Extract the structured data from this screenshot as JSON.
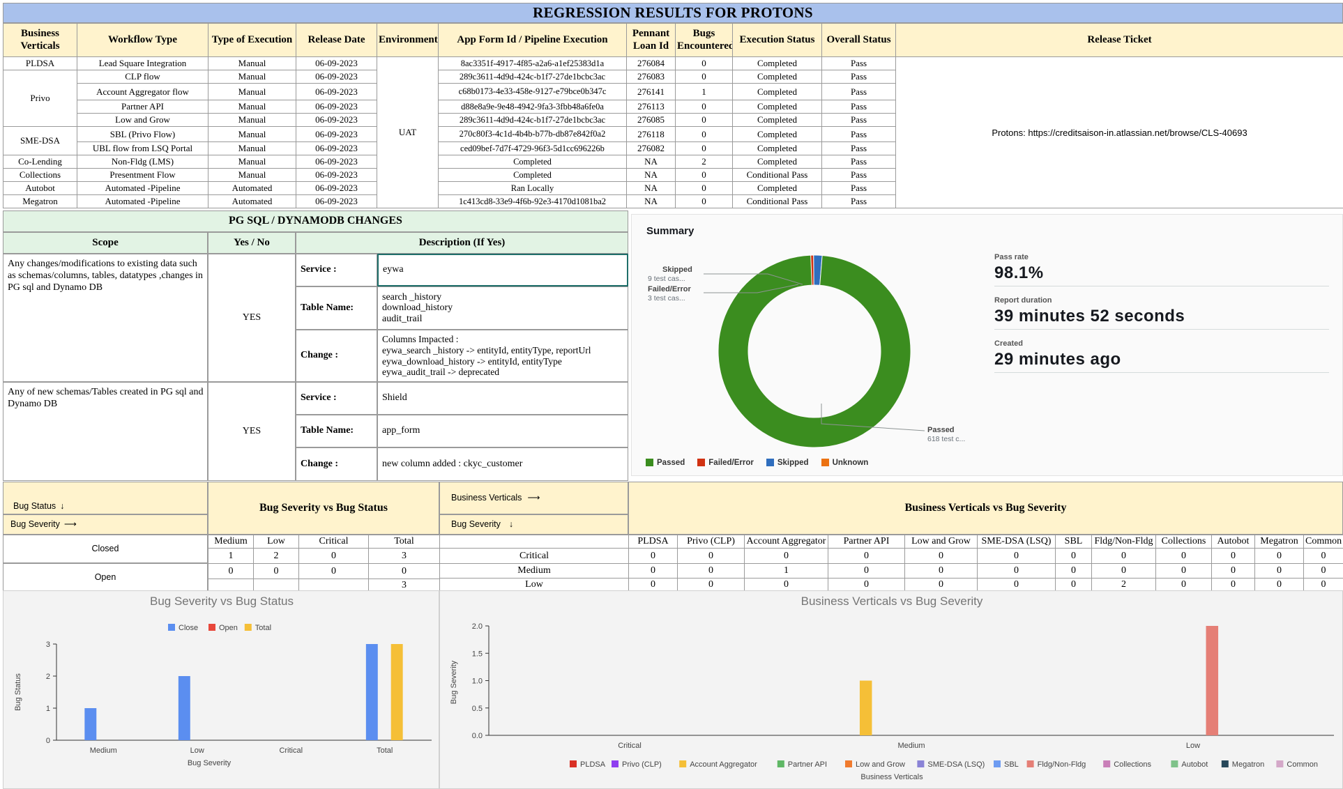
{
  "title": "REGRESSION RESULTS FOR PROTONS",
  "results_table": {
    "headers": [
      "Business Verticals",
      "Workflow Type",
      "Type of Execution",
      "Release Date",
      "Environment",
      "App Form Id / Pipeline Execution",
      "Pennant Loan Id",
      "Bugs Encountered",
      "Execution Status",
      "Overall Status",
      "Release Ticket"
    ],
    "verticals": [
      "PLDSA",
      "Privo",
      "SME-DSA",
      "Co-Lending",
      "Collections",
      "Autobot",
      "Megatron"
    ],
    "environment": "UAT",
    "release_ticket": "Protons: https://creditsaison-in.atlassian.net/browse/CLS-40693",
    "rows": [
      {
        "workflow": "Lead Square Integration",
        "execution": "Manual",
        "date": "06-09-2023",
        "app_id": "8ac3351f-4917-4f85-a2a6-a1ef25383d1a",
        "loan": "276084",
        "bugs": "0",
        "exec_status": "Completed",
        "overall": "Pass"
      },
      {
        "workflow": "CLP flow",
        "execution": "Manual",
        "date": "06-09-2023",
        "app_id": "289c3611-4d9d-424c-b1f7-27de1bcbc3ac",
        "loan": "276083",
        "bugs": "0",
        "exec_status": "Completed",
        "overall": "Pass"
      },
      {
        "workflow": "Account Aggregator flow",
        "execution": "Manual",
        "date": "06-09-2023",
        "app_id": "c68b0173-4e33-458e-9127-e79bce0b347c",
        "loan": "276141",
        "bugs": "1",
        "exec_status": "Completed",
        "overall": "Pass"
      },
      {
        "workflow": "Partner API",
        "execution": "Manual",
        "date": "06-09-2023",
        "app_id": "d88e8a9e-9e48-4942-9fa3-3fbb48a6fe0a",
        "loan": "276113",
        "bugs": "0",
        "exec_status": "Completed",
        "overall": "Pass"
      },
      {
        "workflow": "Low and Grow",
        "execution": "Manual",
        "date": "06-09-2023",
        "app_id": "289c3611-4d9d-424c-b1f7-27de1bcbc3ac",
        "loan": "276085",
        "bugs": "0",
        "exec_status": "Completed",
        "overall": "Pass"
      },
      {
        "workflow": "SBL (Privo Flow)",
        "execution": "Manual",
        "date": "06-09-2023",
        "app_id": "270c80f3-4c1d-4b4b-b77b-db87e842f0a2",
        "loan": "276118",
        "bugs": "0",
        "exec_status": "Completed",
        "overall": "Pass"
      },
      {
        "workflow": "UBL flow from  LSQ Portal",
        "execution": "Manual",
        "date": "06-09-2023",
        "app_id": "ced09bef-7d7f-4729-96f3-5d1cc696226b",
        "loan": "276082",
        "bugs": "0",
        "exec_status": "Completed",
        "overall": "Pass"
      },
      {
        "workflow": "Non-Fldg (LMS)",
        "execution": "Manual",
        "date": "06-09-2023",
        "app_id": "Completed",
        "loan": "NA",
        "bugs": "2",
        "exec_status": "Completed",
        "overall": "Pass"
      },
      {
        "workflow": "Presentment Flow",
        "execution": "Manual",
        "date": "06-09-2023",
        "app_id": "Completed",
        "loan": "NA",
        "bugs": "0",
        "exec_status": "Conditional Pass",
        "overall": "Pass"
      },
      {
        "workflow": "Automated -Pipeline",
        "execution": "Automated",
        "date": "06-09-2023",
        "app_id": "Ran Locally",
        "loan": "NA",
        "bugs": "0",
        "exec_status": "Completed",
        "overall": "Pass"
      },
      {
        "workflow": "Automated -Pipeline",
        "execution": "Automated",
        "date": "06-09-2023",
        "app_id": "1c413cd8-33e9-4f6b-92e3-4170d1081ba2",
        "loan": "NA",
        "bugs": "0",
        "exec_status": "Conditional Pass",
        "overall": "Pass"
      }
    ]
  },
  "db_changes": {
    "title": "PG SQL / DYNAMODB CHANGES",
    "headers": [
      "Scope",
      "Yes / No",
      "Description (If Yes)"
    ],
    "scope1": "Any changes/modifications to existing data  such as schemas/columns, tables, datatypes ,changes in PG sql and Dynamo DB",
    "yes1": "YES",
    "service_label": "Service :",
    "table_label": "Table Name:",
    "change_label": "Change :",
    "service1": "eywa",
    "tables1": "search _history\ndownload_history\naudit_trail",
    "change1": "Columns Impacted :\neywa_search _history -> entityId, entityType, reportUrl\neywa_download_history -> entityId, entityType\neywa_audit_trail -> deprecated",
    "scope2": "Any of new schemas/Tables created in PG sql and Dynamo DB",
    "yes2": "YES",
    "service2": "Shield",
    "tables2": "app_form",
    "change2": "new column added : ckyc_customer"
  },
  "summary": {
    "title": "Summary",
    "pass_rate_label": "Pass rate",
    "pass_rate": "98.1%",
    "duration_label": "Report duration",
    "duration": "39 minutes 52 seconds",
    "created_label": "Created",
    "created": "29 minutes ago",
    "callout_skipped": "Skipped",
    "callout_skipped_sub": "9 test cas...",
    "callout_failed": "Failed/Error",
    "callout_failed_sub": "3 test cas...",
    "callout_passed": "Passed",
    "callout_passed_sub": "618 test c...",
    "legend": [
      {
        "label": "Passed",
        "color": "#3b8d1f"
      },
      {
        "label": "Failed/Error",
        "color": "#d13212"
      },
      {
        "label": "Skipped",
        "color": "#2f6ebe"
      },
      {
        "label": "Unknown",
        "color": "#ec7211"
      }
    ],
    "donut": {
      "passed": 618,
      "failed": 3,
      "skipped": 9,
      "unknown": 0
    }
  },
  "bug_status": {
    "title": "Bug Severity vs  Bug Status",
    "bug_status_label": "Bug Status",
    "bug_severity_label": "Bug Severity",
    "columns": [
      "Medium",
      "Low",
      "Critical",
      "Total"
    ],
    "rows": [
      {
        "label": "Closed",
        "values": [
          "1",
          "2",
          "0",
          "3"
        ]
      },
      {
        "label": "Open",
        "values": [
          "0",
          "0",
          "0",
          "0"
        ]
      },
      {
        "label": "",
        "values": [
          "",
          "",
          "",
          "3"
        ]
      }
    ]
  },
  "bv_severity": {
    "title": "Business Verticals vs Bug Severity",
    "bv_label": "Business Verticals",
    "severity_label": "Bug Severity",
    "columns": [
      "PLDSA",
      "Privo (CLP)",
      "Account Aggregator",
      "Partner API",
      "Low and Grow",
      "SME-DSA (LSQ)",
      "SBL",
      "Fldg/Non-Fldg",
      "Collections",
      "Autobot",
      "Megatron",
      "Common"
    ],
    "rows": [
      {
        "label": "Critical",
        "values": [
          "0",
          "0",
          "0",
          "0",
          "0",
          "0",
          "0",
          "0",
          "0",
          "0",
          "0",
          "0"
        ]
      },
      {
        "label": "Medium",
        "values": [
          "0",
          "0",
          "1",
          "0",
          "0",
          "0",
          "0",
          "0",
          "0",
          "0",
          "0",
          "0"
        ]
      },
      {
        "label": "Low",
        "values": [
          "0",
          "0",
          "0",
          "0",
          "0",
          "0",
          "0",
          "2",
          "0",
          "0",
          "0",
          "0"
        ]
      }
    ]
  },
  "chart_data": [
    {
      "type": "bar",
      "title": "Bug Severity vs Bug Status",
      "xlabel": "Bug Severity",
      "ylabel": "Bug Status",
      "categories": [
        "Medium",
        "Low",
        "Critical",
        "Total"
      ],
      "ylim": [
        0,
        3
      ],
      "yticks": [
        "0",
        "1",
        "2",
        "3"
      ],
      "legend_position": "top",
      "series": [
        {
          "name": "Close",
          "color": "#5b8ef0",
          "values": [
            1,
            2,
            0,
            3
          ]
        },
        {
          "name": "Open",
          "color": "#e8473b",
          "values": [
            0,
            0,
            0,
            0
          ]
        },
        {
          "name": "Total",
          "color": "#f5bf37",
          "values": [
            0,
            0,
            0,
            3
          ]
        }
      ]
    },
    {
      "type": "bar",
      "title": "Business Verticals vs Bug Severity",
      "xlabel": "Business Verticals",
      "ylabel": "Bug Severity",
      "categories": [
        "Critical",
        "Medium",
        "Low"
      ],
      "ylim": [
        0,
        2
      ],
      "yticks": [
        "0.0",
        "0.5",
        "1.0",
        "1.5",
        "2.0"
      ],
      "legend_position": "bottom",
      "series": [
        {
          "name": "PLDSA",
          "color": "#d93025",
          "values": [
            0,
            0,
            0
          ]
        },
        {
          "name": "Privo (CLP)",
          "color": "#8f3ff0",
          "values": [
            0,
            0,
            0
          ]
        },
        {
          "name": "Account Aggregator",
          "color": "#f5bf37",
          "values": [
            0,
            1,
            0
          ]
        },
        {
          "name": "Partner API",
          "color": "#5fb765",
          "values": [
            0,
            0,
            0
          ]
        },
        {
          "name": "Low and Grow",
          "color": "#f07a2d",
          "values": [
            0,
            0,
            0
          ]
        },
        {
          "name": "SME-DSA (LSQ)",
          "color": "#8a83d6",
          "values": [
            0,
            0,
            0
          ]
        },
        {
          "name": "SBL",
          "color": "#6d9bf1",
          "values": [
            0,
            0,
            0
          ]
        },
        {
          "name": "Fldg/Non-Fldg",
          "color": "#e57f76",
          "values": [
            0,
            0,
            2
          ]
        },
        {
          "name": "Collections",
          "color": "#c97fb8",
          "values": [
            0,
            0,
            0
          ]
        },
        {
          "name": "Autobot",
          "color": "#7fc28a",
          "values": [
            0,
            0,
            0
          ]
        },
        {
          "name": "Megatron",
          "color": "#27485a",
          "values": [
            0,
            0,
            0
          ]
        },
        {
          "name": "Common",
          "color": "#d4a8c8",
          "values": [
            0,
            0,
            0
          ]
        }
      ]
    }
  ]
}
